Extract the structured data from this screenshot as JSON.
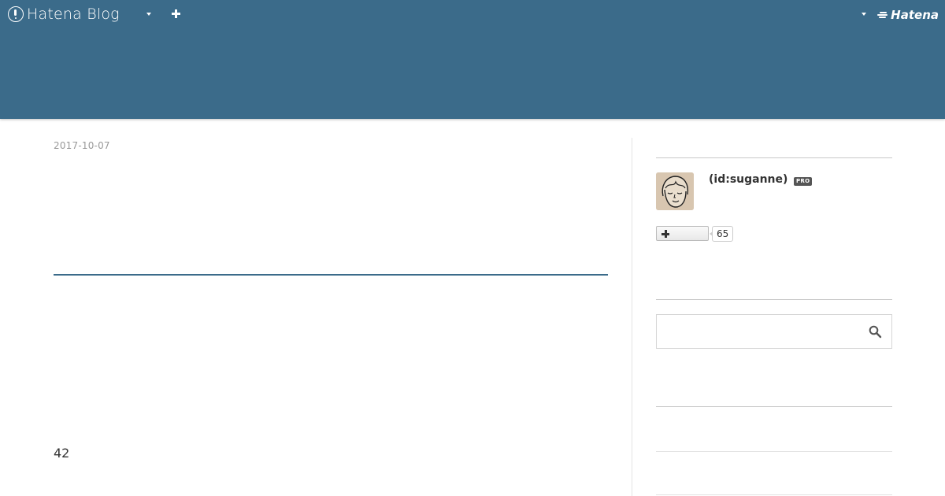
{
  "globalbar": {
    "brand": "Hatena Blog",
    "hatena_logo": "Hatena"
  },
  "colors": {
    "header": "#3b6b8a",
    "accent_rule": "#3b6b8a"
  },
  "icons": {
    "brand": "hatena-blog-icon",
    "menu_caret": "caret-down-icon",
    "new_post": "plus-icon",
    "account_caret": "caret-down-icon",
    "hatena": "hatena-logo-icon",
    "subscribe": "plus-icon",
    "search": "search-icon"
  },
  "entry": {
    "date": "2017-10-07",
    "content_number": "42"
  },
  "sidebar": {
    "profile": {
      "id": "(id:suganne)",
      "badge": "PRO",
      "subscribers": "65"
    },
    "search": {
      "value": "",
      "placeholder": ""
    }
  }
}
